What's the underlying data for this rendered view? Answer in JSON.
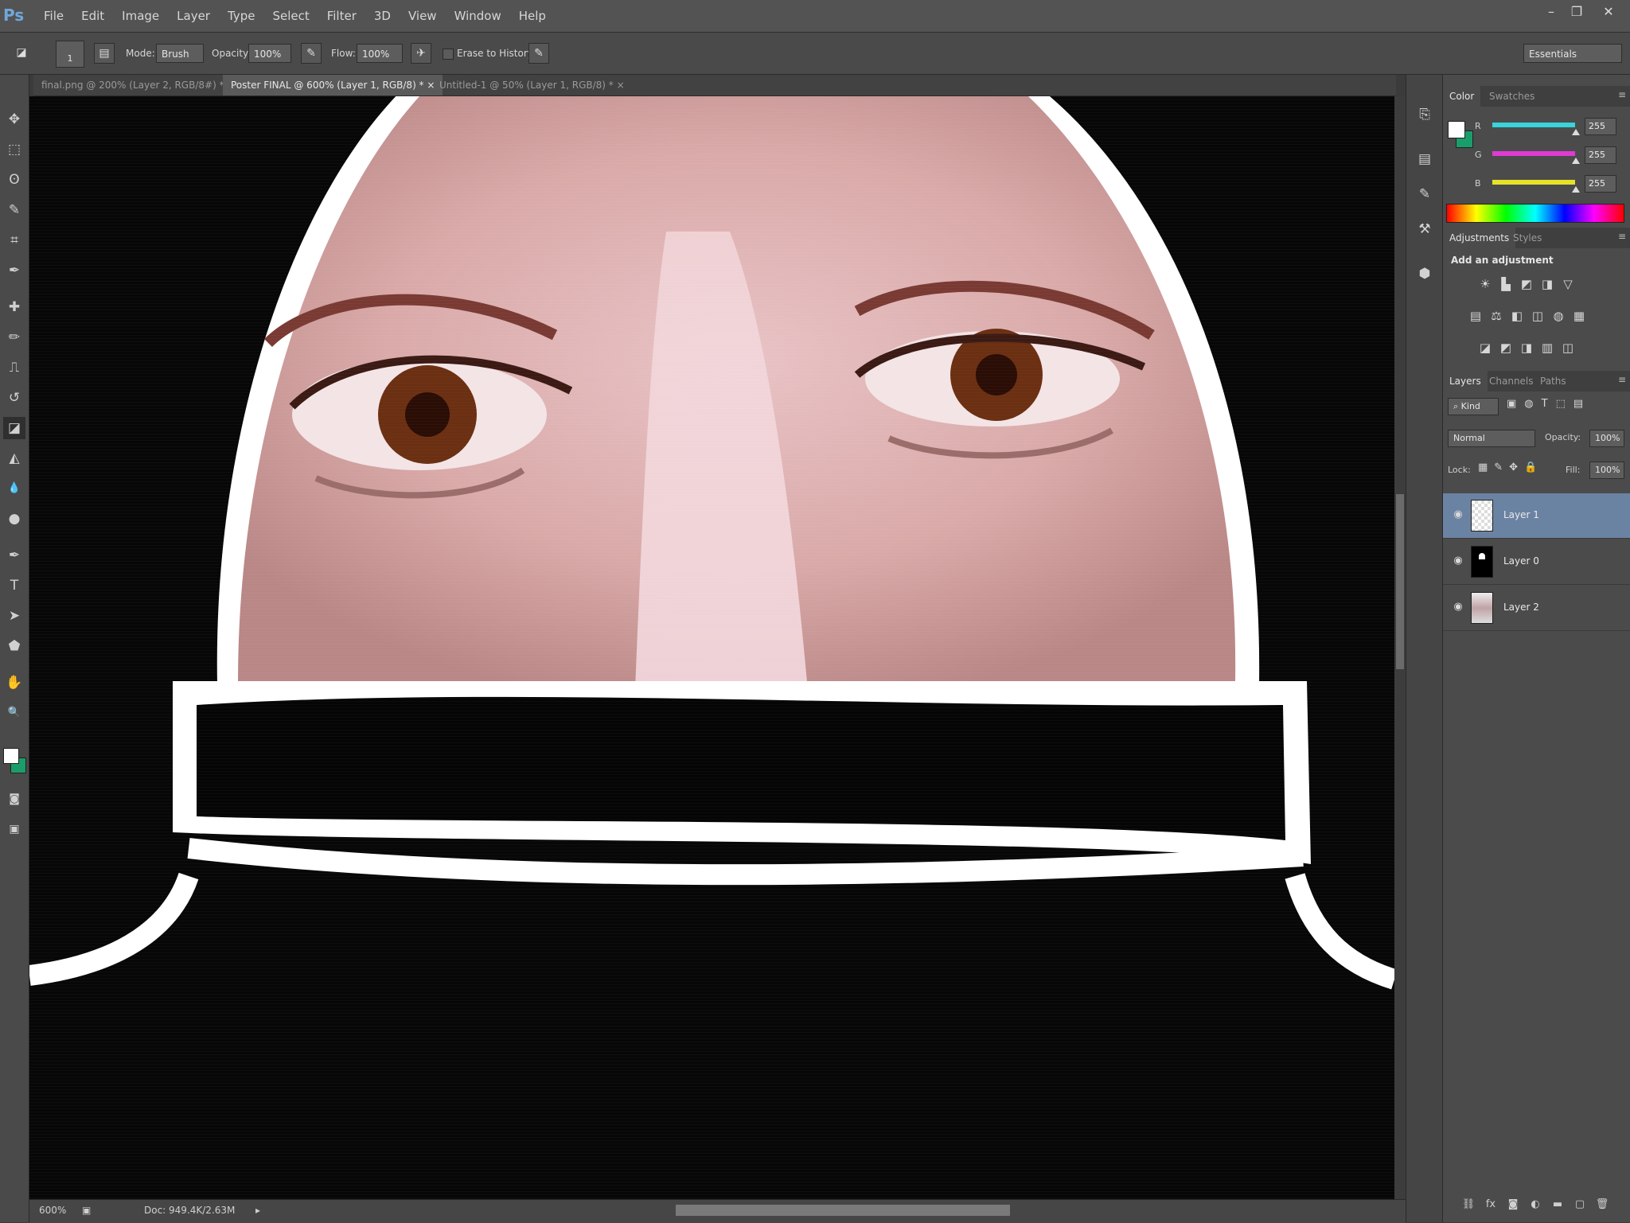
{
  "app": {
    "logo": "Ps",
    "menu": [
      "File",
      "Edit",
      "Image",
      "Layer",
      "Type",
      "Select",
      "Filter",
      "3D",
      "View",
      "Window",
      "Help"
    ],
    "window_controls": [
      "minimize-icon",
      "restore-icon",
      "close-icon"
    ],
    "window_glyphs": {
      "minimize": "–",
      "restore": "❐",
      "close": "✕"
    }
  },
  "options_bar": {
    "brush_size": "1",
    "mode_label": "Mode:",
    "mode_value": "Brush",
    "opacity_label": "Opacity:",
    "opacity_value": "100%",
    "flow_label": "Flow:",
    "flow_value": "100%",
    "erase_to_history": "Erase to History",
    "workspace": "Essentials"
  },
  "document_tabs": [
    {
      "label": "final.png @ 200% (Layer 2, RGB/8#) *",
      "active": false
    },
    {
      "label": "Poster FINAL @ 600% (Layer 1, RGB/8) *",
      "active": true
    },
    {
      "label": "Untitled-1 @ 50% (Layer 1, RGB/8) *",
      "active": false
    }
  ],
  "tools": [
    "move-icon",
    "marquee-icon",
    "lasso-icon",
    "quick-select-icon",
    "crop-icon",
    "eyedropper-icon",
    "healing-brush-icon",
    "brush-icon",
    "clone-stamp-icon",
    "history-brush-icon",
    "eraser-icon",
    "paint-bucket-icon",
    "blur-icon",
    "dodge-icon",
    "pen-icon",
    "type-icon",
    "path-select-icon",
    "shape-icon",
    "hand-icon",
    "zoom-icon"
  ],
  "tool_glyphs": [
    "✥",
    "⬚",
    "ʘ",
    "✎",
    "⌗",
    "✒",
    "✚",
    "✏",
    "⎍",
    "↺",
    "◪",
    "◭",
    "💧",
    "●",
    "✒",
    "T",
    "➤",
    "⬟",
    "✋",
    "🔍"
  ],
  "colors": {
    "foreground": "#ffffff",
    "background": "#1a9d6a",
    "accent_selected": "#6b83a3"
  },
  "color_panel": {
    "tabs": [
      "Color",
      "Swatches"
    ],
    "channels": [
      {
        "label": "R",
        "value": "255",
        "color": "#38d3dc"
      },
      {
        "label": "G",
        "value": "255",
        "color": "#e03ad4"
      },
      {
        "label": "B",
        "value": "255",
        "color": "#e5e22a"
      }
    ]
  },
  "adjustments_panel": {
    "tabs": [
      "Adjustments",
      "Styles"
    ],
    "heading": "Add an adjustment",
    "icons": [
      "brightness-icon",
      "levels-icon",
      "curves-icon",
      "exposure-icon",
      "vibrance-icon",
      "hue-saturation-icon",
      "color-balance-icon",
      "black-white-icon",
      "photo-filter-icon",
      "channel-mixer-icon",
      "color-lookup-icon",
      "invert-icon",
      "posterize-icon",
      "threshold-icon",
      "gradient-map-icon",
      "selective-color-icon"
    ],
    "glyphs": [
      "☀",
      "▙",
      "◩",
      "◨",
      "▽",
      "▤",
      "⚖",
      "◧",
      "◫",
      "◍",
      "▦",
      "◪",
      "◩",
      "◨",
      "▥",
      "◫"
    ]
  },
  "layers_panel": {
    "tabs": [
      "Layers",
      "Channels",
      "Paths"
    ],
    "kind_filter": "Kind",
    "blend_mode": "Normal",
    "opacity_label": "Opacity:",
    "opacity_value": "100%",
    "lock_label": "Lock:",
    "fill_label": "Fill:",
    "fill_value": "100%",
    "layers": [
      {
        "name": "Layer 1",
        "selected": true
      },
      {
        "name": "Layer 0",
        "selected": false
      },
      {
        "name": "Layer 2",
        "selected": false
      }
    ]
  },
  "status": {
    "zoom": "600%",
    "doc_info": "Doc: 949.4K/2.63M"
  }
}
